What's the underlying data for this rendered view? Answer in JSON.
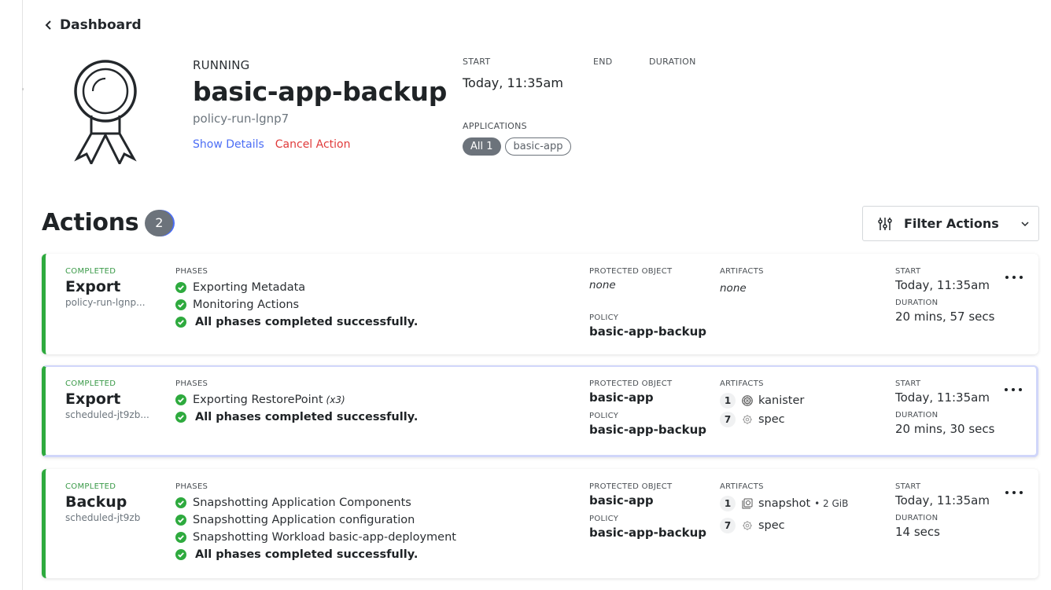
{
  "nav": {
    "back_label": "Dashboard"
  },
  "hero": {
    "status": "RUNNING",
    "title": "basic-app-backup",
    "subtitle": "policy-run-lgnp7",
    "show_details": "Show Details",
    "cancel_action": "Cancel Action"
  },
  "meta": {
    "start_label": "START",
    "start_value": "Today, 11:35am",
    "end_label": "END",
    "end_value": "",
    "duration_label": "DURATION",
    "duration_value": "",
    "applications_label": "APPLICATIONS",
    "applications": [
      "All 1",
      "basic-app"
    ]
  },
  "actions": {
    "title": "Actions",
    "count": "2",
    "filter_label": "Filter Actions",
    "labels": {
      "phases": "PHASES",
      "protected_object": "PROTECTED OBJECT",
      "policy": "POLICY",
      "artifacts": "ARTIFACTS",
      "start": "START",
      "duration": "DURATION"
    },
    "colors": {
      "completed": "#2eaa3e",
      "link": "#4c6ef5",
      "danger": "#e03b3b"
    },
    "items": [
      {
        "status": "COMPLETED",
        "type": "Export",
        "sub": "policy-run-lgnp...",
        "phases": [
          "Exporting Metadata",
          "Monitoring Actions"
        ],
        "final_phase": "All phases completed successfully.",
        "protected_object": "none",
        "policy": "basic-app-backup",
        "artifacts_none": "none",
        "start": "Today, 11:35am",
        "duration": "20 mins, 57 secs"
      },
      {
        "status": "COMPLETED",
        "type": "Export",
        "sub": "scheduled-jt9zb...",
        "phases": [
          "Exporting RestorePoint"
        ],
        "phase_multiplier": "(x3)",
        "final_phase": "All phases completed successfully.",
        "protected_object": "basic-app",
        "policy": "basic-app-backup",
        "artifacts": [
          {
            "count": "1",
            "icon": "kanister-icon",
            "name": "kanister"
          },
          {
            "count": "7",
            "icon": "spec-icon",
            "name": "spec"
          }
        ],
        "start": "Today, 11:35am",
        "duration": "20 mins, 30 secs"
      },
      {
        "status": "COMPLETED",
        "type": "Backup",
        "sub": "scheduled-jt9zb",
        "phases": [
          "Snapshotting Application Components",
          "Snapshotting Application configuration",
          "Snapshotting Workload basic-app-deployment"
        ],
        "final_phase": "All phases completed successfully.",
        "protected_object": "basic-app",
        "policy": "basic-app-backup",
        "artifacts": [
          {
            "count": "1",
            "icon": "snapshot-icon",
            "name": "snapshot",
            "size": "• 2 GiB"
          },
          {
            "count": "7",
            "icon": "spec-icon",
            "name": "spec"
          }
        ],
        "start": "Today, 11:35am",
        "duration": "14 secs"
      }
    ]
  }
}
